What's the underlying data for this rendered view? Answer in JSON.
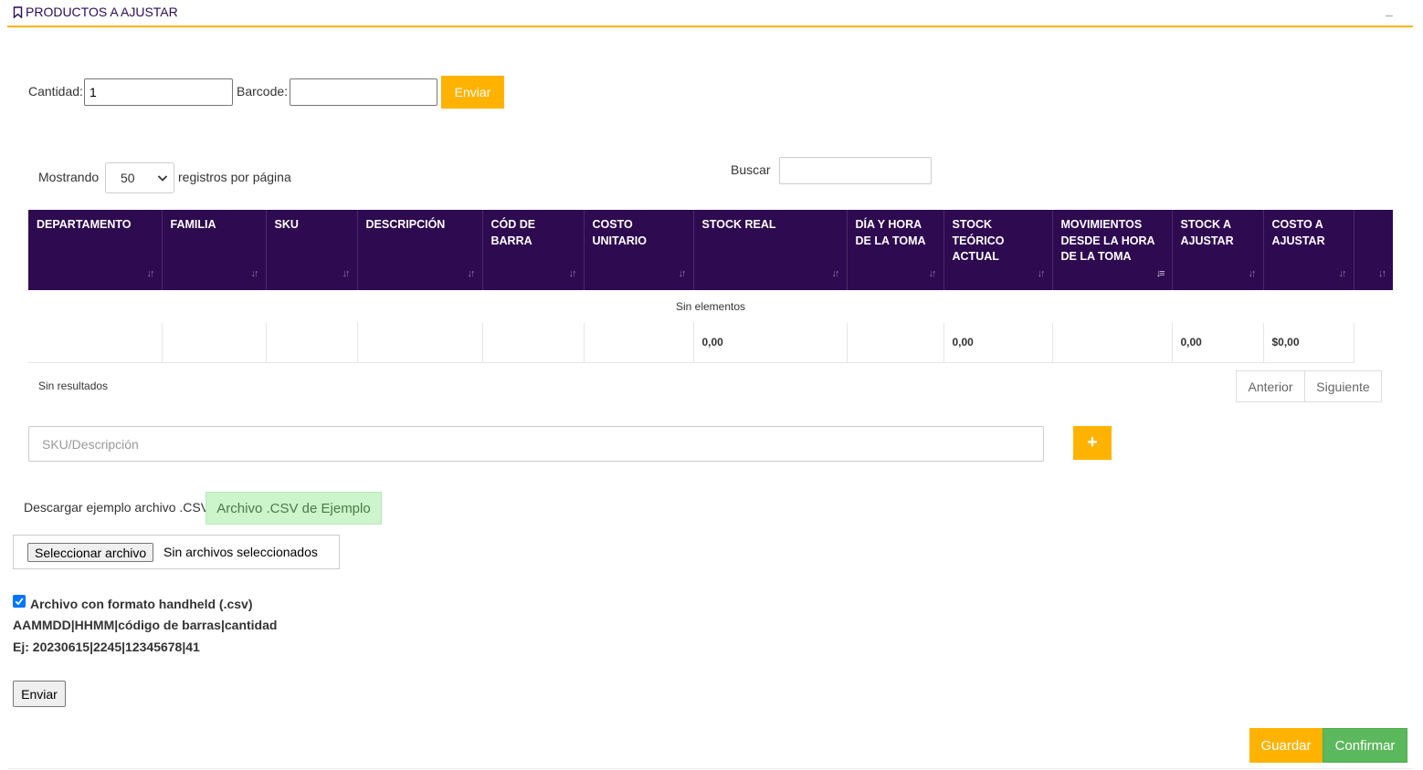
{
  "header": {
    "title": "PRODUCTOS A AJUSTAR",
    "collapse_symbol": "–"
  },
  "quick_add": {
    "quantity_label": "Cantidad:",
    "quantity_value": "1",
    "barcode_label": "Barcode:",
    "barcode_value": "",
    "submit_label": "Enviar"
  },
  "table_controls": {
    "showing_prefix": "Mostrando",
    "page_size": "50",
    "showing_suffix": "registros por página",
    "search_label": "Buscar",
    "search_value": ""
  },
  "table": {
    "columns": [
      "DEPARTAMENTO",
      "FAMILIA",
      "SKU",
      "DESCRIPCIÓN",
      "CÓD DE BARRA",
      "COSTO UNITARIO",
      "STOCK REAL",
      "DÍA Y HORA DE LA TOMA",
      "STOCK TEÓRICO ACTUAL",
      "MOVIMIENTOS DESDE LA HORA DE LA TOMA",
      "STOCK A AJUSTAR",
      "COSTO A AJUSTAR",
      ""
    ],
    "empty_message": "Sin elementos",
    "totals": {
      "stock_real": "0,00",
      "stock_teorico": "0,00",
      "stock_a_ajustar": "0,00",
      "costo_a_ajustar": "$0,00"
    },
    "info": "Sin resultados",
    "prev_label": "Anterior",
    "next_label": "Siguiente"
  },
  "sku_search": {
    "placeholder": "SKU/Descripción",
    "add_symbol": "+"
  },
  "csv": {
    "download_label": "Descargar ejemplo archivo .CSV",
    "download_button": "Archivo .CSV de Ejemplo",
    "file_button": "Seleccionar archivo",
    "file_status": "Sin archivos seleccionados",
    "handheld_label": "Archivo con formato handheld (.csv)",
    "handheld_checked": true,
    "format_line": "AAMMDD|HHMM|código de barras|cantidad",
    "example_line": "Ej: 20230615|2245|12345678|41",
    "send_label": "Enviar"
  },
  "footer": {
    "save_label": "Guardar",
    "confirm_label": "Confirmar"
  },
  "colors": {
    "accent": "#ffb300",
    "table_header": "#2e0a50",
    "confirm": "#5cb85c",
    "csv_button": "#ccf5cc"
  },
  "icons": {
    "header": "bookmark-icon",
    "sort": "sort-arrows-icon",
    "sort_active": "sort-amount-down-icon",
    "checkbox": "checkmark-icon"
  }
}
